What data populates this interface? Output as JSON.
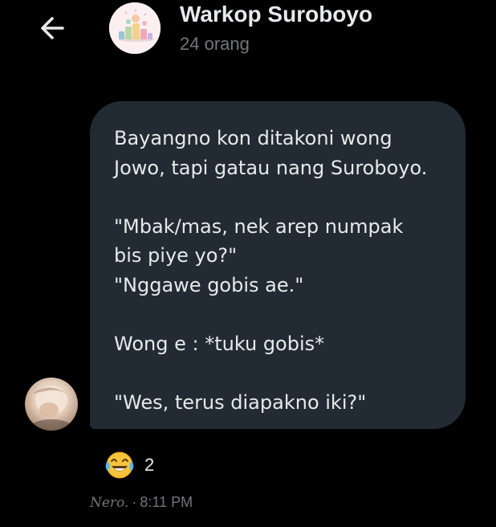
{
  "header": {
    "back_icon": "arrow-left-icon",
    "group_name": "Warkop Suroboyo",
    "member_count": "24 orang"
  },
  "message": {
    "lines": [
      "Bayangno kon ditakoni wong",
      "Jowo, tapi gatau nang Suroboyo.",
      "",
      "\"Mbak/mas, nek arep numpak",
      "bis piye yo?\"",
      "\"Nggawe gobis ae.\"",
      "",
      "Wong e : *tuku gobis*",
      "",
      "\"Wes, terus diapakno iki?\""
    ],
    "reaction": {
      "emoji": "😂",
      "icon": "face-with-tears-of-joy-icon",
      "count": "2"
    },
    "sender_name": "Nero.",
    "separator": "·",
    "time": "8:11 PM"
  },
  "colors": {
    "background": "#000000",
    "bubble": "#222b33",
    "primary_text": "#e7e9ea",
    "secondary_text": "#71767b"
  }
}
